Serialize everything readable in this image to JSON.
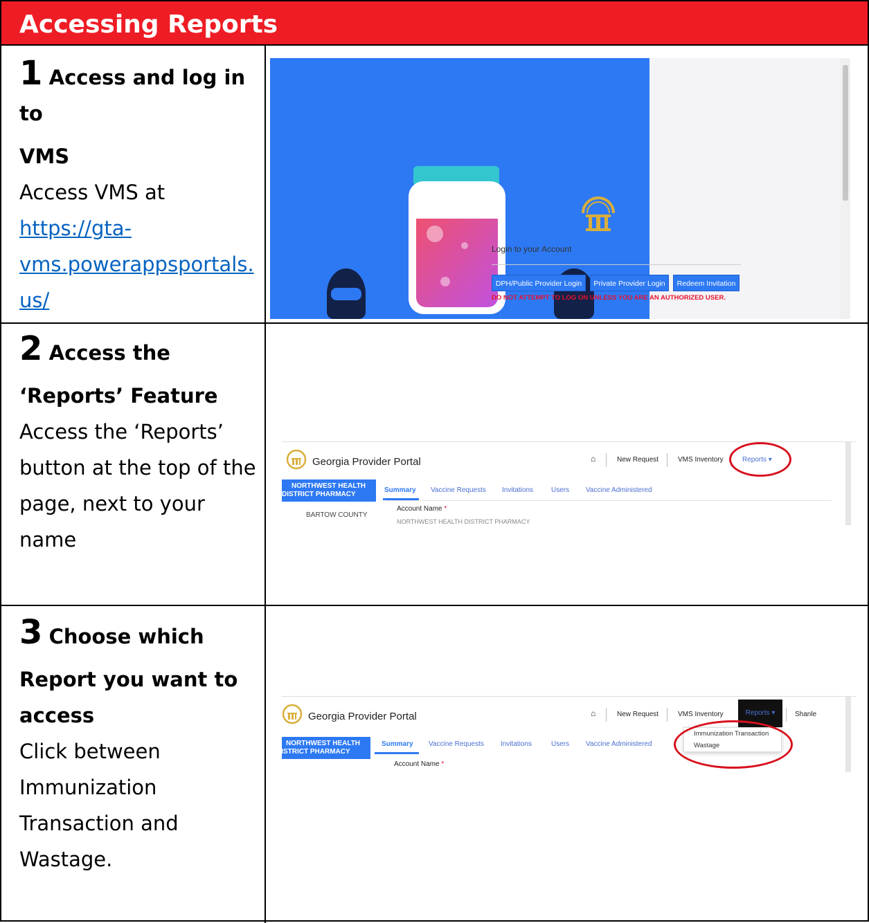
{
  "title": "Accessing Reports",
  "steps": [
    {
      "number": "1",
      "heading_a": "Access and log in to",
      "heading_b": "VMS",
      "body_lines": [
        "Access VMS at"
      ],
      "link_lines": [
        "https://gta-",
        "vms.powerappsportals.",
        "us/"
      ]
    },
    {
      "number": "2",
      "heading_a": "Access the",
      "heading_b": "‘Reports’ Feature",
      "body_lines": [
        "Access the ‘Reports’",
        "button at the top of the",
        "page, next to your",
        "name"
      ]
    },
    {
      "number": "3",
      "heading_a": "Choose which",
      "heading_b": "Report you want to",
      "heading_c": "access",
      "body_lines": [
        "Click between",
        "Immunization",
        "Transaction and",
        "Wastage."
      ]
    }
  ],
  "login_screen": {
    "title": "Login to your Account",
    "buttons": [
      "DPH/Public Provider Login",
      "Private Provider Login",
      "Redeem Invitation"
    ],
    "warning": "DO NOT ATTEMPT TO LOG ON UNLESS YOU ARE AN AUTHORIZED USER."
  },
  "portal": {
    "title": "Georgia Provider Portal",
    "nav": [
      "New Request",
      "VMS Inventory",
      "Reports ▾"
    ],
    "user": "Shanle",
    "sidebar_org": [
      "NORTHWEST HEALTH",
      "DISTRICT PHARMACY"
    ],
    "sidebar_item": "BARTOW COUNTY",
    "tabs": [
      "Summary",
      "Vaccine Requests",
      "Invitations",
      "Users",
      "Vaccine Administered"
    ],
    "field_label": "Account Name",
    "required_mark": "*",
    "field_value_partial": "NORTHWEST HEALTH DISTRICT PHARMACY",
    "reports_menu": [
      "Immunization Transaction",
      "Wastage"
    ]
  },
  "colors": {
    "title_bar": "#ee1c25",
    "accent_blue": "#2d79f3",
    "highlight_oval": "#d7111d"
  }
}
